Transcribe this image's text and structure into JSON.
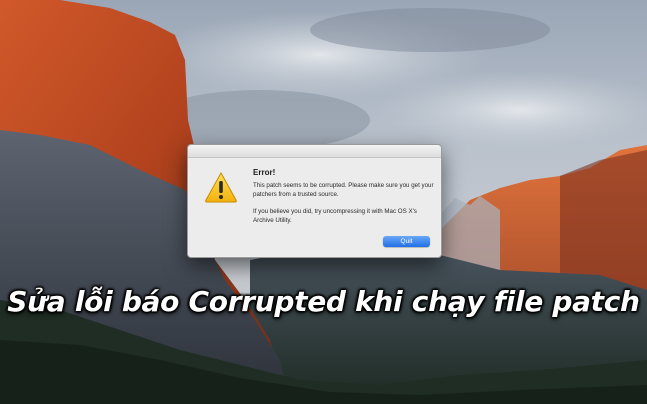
{
  "dialog": {
    "icon": "warning-icon",
    "title": "Error!",
    "message": "This patch seems to be corrupted. Please make sure you get your patchers from a trusted source.",
    "hint": "If you believe you did, try uncompressing it with Mac OS X's Archive Utility.",
    "quit_label": "Quit"
  },
  "caption": "Sửa lỗi báo Corrupted khi chạy file patch",
  "colors": {
    "button_accent": "#2f7cf0",
    "warning_yellow": "#f5c518",
    "caption_text": "#ffffff"
  }
}
